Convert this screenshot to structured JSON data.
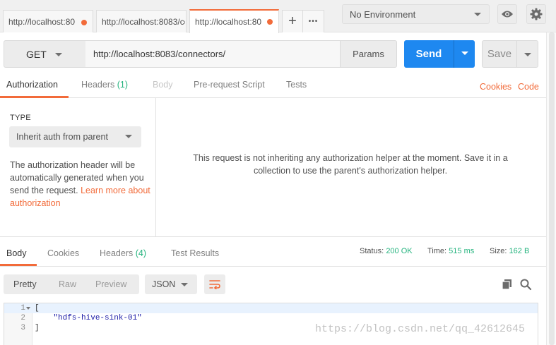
{
  "tabs": [
    {
      "label": "http://localhost:80",
      "modified": true
    },
    {
      "label": "http://localhost:8083/co",
      "modified": false
    },
    {
      "label": "http://localhost:80",
      "modified": true
    }
  ],
  "tab_actions": {
    "add": "+",
    "more": "•••"
  },
  "environment": {
    "selected": "No Environment"
  },
  "request": {
    "method": "GET",
    "url": "http://localhost:8083/connectors/",
    "params_label": "Params",
    "send_label": "Send",
    "save_label": "Save"
  },
  "request_tabs": {
    "authorization": "Authorization",
    "headers": "Headers",
    "headers_count": "(1)",
    "body": "Body",
    "pre_request": "Pre-request Script",
    "tests": "Tests",
    "cookies": "Cookies",
    "code": "Code"
  },
  "auth": {
    "type_label": "TYPE",
    "type_value": "Inherit auth from parent",
    "description": "The authorization header will be automatically generated when you send the request. ",
    "learn_link": "Learn more about authorization",
    "message": "This request is not inheriting any authorization helper at the moment. Save it in a collection to use the parent's authorization helper."
  },
  "response_tabs": {
    "body": "Body",
    "cookies": "Cookies",
    "headers": "Headers",
    "headers_count": "(4)",
    "test_results": "Test Results"
  },
  "status": {
    "status_label": "Status:",
    "status_value": "200 OK",
    "time_label": "Time:",
    "time_value": "515 ms",
    "size_label": "Size:",
    "size_value": "162 B"
  },
  "response_view": {
    "pretty": "Pretty",
    "raw": "Raw",
    "preview": "Preview",
    "format": "JSON"
  },
  "code_lines": [
    {
      "num": "1",
      "text": "["
    },
    {
      "num": "2",
      "text": "    \"hdfs-hive-sink-01\""
    },
    {
      "num": "3",
      "text": "]"
    }
  ],
  "watermark": "https://blog.csdn.net/qq_42612645",
  "colors": {
    "accent": "#f26b3a",
    "send": "#1e88f0",
    "success": "#26b47f"
  }
}
